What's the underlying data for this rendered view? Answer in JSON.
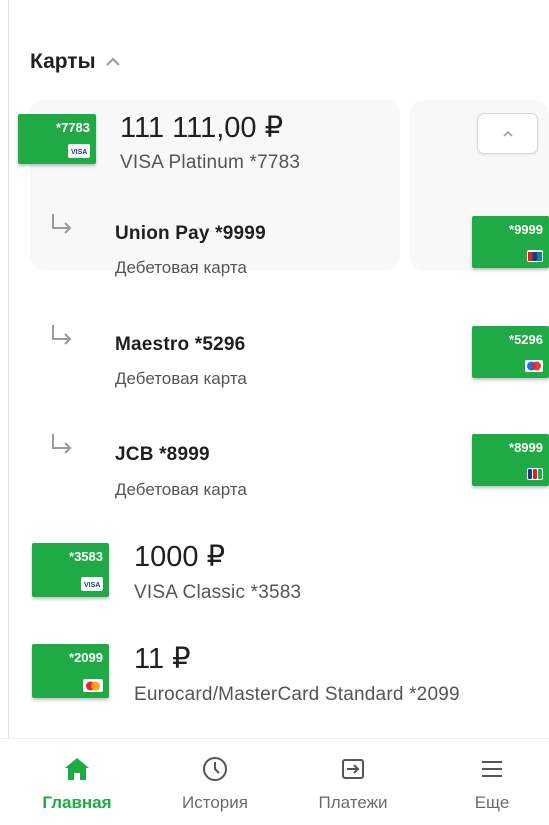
{
  "section": {
    "title": "Карты"
  },
  "main_card": {
    "thumb_number": "*7783",
    "amount": "111 111,00 ₽",
    "description": "VISA Platinum *7783",
    "logo": "visa-logo"
  },
  "sub_cards": [
    {
      "name": "Union Pay *9999",
      "type": "Дебетовая карта",
      "thumb_number": "*9999",
      "logo": "unionpay-logo"
    },
    {
      "name": "Maestro *5296",
      "type": "Дебетовая карта",
      "thumb_number": "*5296",
      "logo": "maestro-logo"
    },
    {
      "name": "JCB *8999",
      "type": "Дебетовая карта",
      "thumb_number": "*8999",
      "logo": "jcb-logo"
    }
  ],
  "cards": [
    {
      "thumb_number": "*3583",
      "amount": "1000 ₽",
      "description": "VISA Classic *3583",
      "logo": "visa-logo"
    },
    {
      "thumb_number": "*2099",
      "amount": "11 ₽",
      "description": "Eurocard/MasterCard Standard *2099",
      "logo": "mastercard-logo"
    }
  ],
  "nav": {
    "items": [
      {
        "label": "Главная",
        "icon": "home-icon",
        "active": true
      },
      {
        "label": "История",
        "icon": "clock-icon",
        "active": false
      },
      {
        "label": "Платежи",
        "icon": "transfer-icon",
        "active": false
      },
      {
        "label": "Еще",
        "icon": "menu-icon",
        "active": false
      }
    ]
  },
  "colors": {
    "accent": "#1faa45",
    "text": "#1f1f1f",
    "muted": "#555555"
  }
}
